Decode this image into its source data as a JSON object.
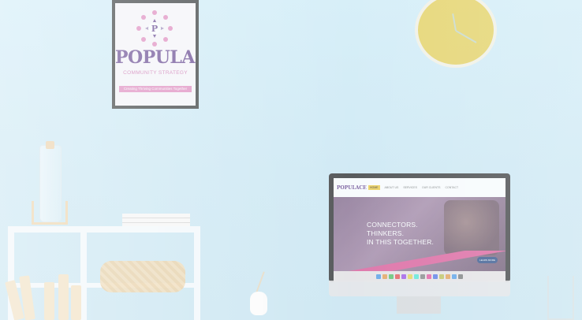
{
  "poster": {
    "title": "POPULACE",
    "subtitle": "COMMUNITY STRATEGY",
    "tagline": "Creating Thriving Communities Together"
  },
  "monitor": {
    "site_logo": "POPULACE",
    "nav": [
      "HOME",
      "ABOUT US",
      "SERVICES",
      "OUR CLIENTS",
      "CONTACT"
    ],
    "hero_lines": [
      "CONNECTORS.",
      "THINKERS.",
      "IN THIS TOGETHER."
    ],
    "cta": "LEARN MORE"
  },
  "colors": {
    "wall": "#d5eef8",
    "brand_purple": "#6c4a92",
    "brand_pink": "#e05f9c",
    "clock_face": "#e9d25f"
  }
}
